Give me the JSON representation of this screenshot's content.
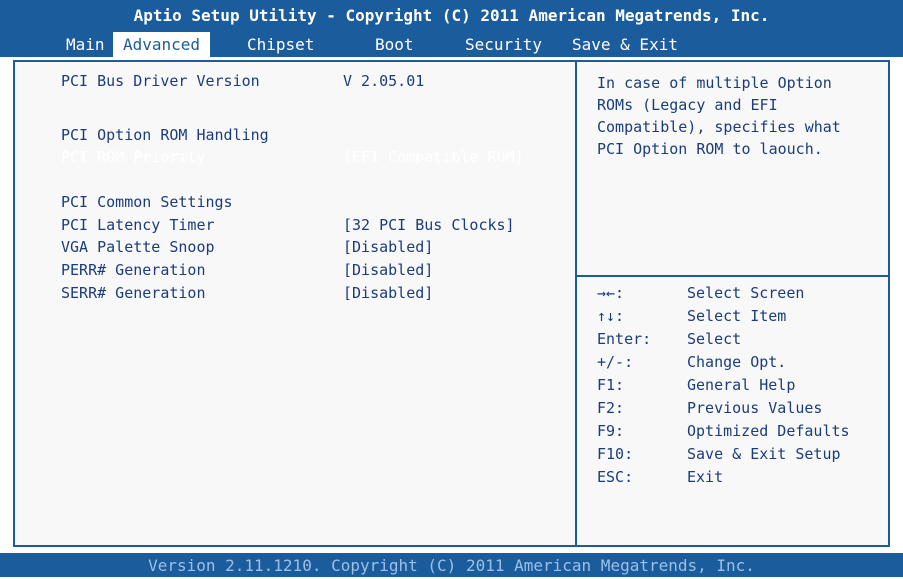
{
  "title": "Aptio Setup Utility - Copyright (C) 2011 American Megatrends, Inc.",
  "tabs": [
    "Main",
    "Advanced",
    "Chipset",
    "Boot",
    "Security",
    "Save & Exit"
  ],
  "active_tab": "Advanced",
  "settings": {
    "driver_version_label": "PCI Bus Driver Version",
    "driver_version_value": "V 2.05.01",
    "rom_handling_header": "PCI Option ROM Handling",
    "rom_priority_label": "PCI ROM Priority",
    "rom_priority_value": "[EFI Compatible ROM]",
    "common_header": "PCI Common Settings",
    "latency_label": "PCI Latency Timer",
    "latency_value": "[32 PCI Bus Clocks]",
    "vga_label": "VGA Palette Snoop",
    "vga_value": "[Disabled]",
    "perr_label": "PERR# Generation",
    "perr_value": "[Disabled]",
    "serr_label": "SERR# Generation",
    "serr_value": "[Disabled]"
  },
  "help": {
    "line1": "In case of multiple Option",
    "line2": "ROMs (Legacy and EFI",
    "line3": "Compatible), specifies what",
    "line4": "PCI Option ROM to laouch."
  },
  "keys": [
    {
      "key": "→←:",
      "desc": "Select Screen"
    },
    {
      "key": "↑↓:",
      "desc": "Select Item"
    },
    {
      "key": "Enter:",
      "desc": "Select"
    },
    {
      "key": "+/-:",
      "desc": "Change Opt."
    },
    {
      "key": "F1:",
      "desc": "General Help"
    },
    {
      "key": "F2:",
      "desc": "Previous Values"
    },
    {
      "key": "F9:",
      "desc": "Optimized Defaults"
    },
    {
      "key": "F10:",
      "desc": "Save & Exit Setup"
    },
    {
      "key": "ESC:",
      "desc": "Exit"
    }
  ],
  "footer": "Version 2.11.1210. Copyright (C) 2011 American Megatrends, Inc.",
  "colors": {
    "bios_blue": "#1b5c9c",
    "text_blue": "#1b3c7c",
    "selected_text": "#ffffff",
    "footer_text": "#9bc0e8"
  }
}
